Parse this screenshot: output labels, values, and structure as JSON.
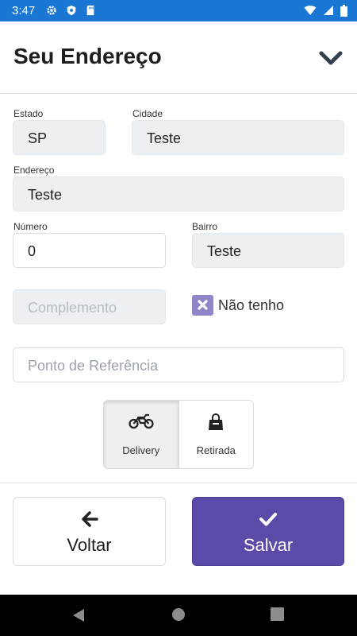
{
  "status_bar": {
    "time": "3:47"
  },
  "header": {
    "title": "Seu Endereço"
  },
  "form": {
    "estado": {
      "label": "Estado",
      "value": "SP"
    },
    "cidade": {
      "label": "Cidade",
      "value": "Teste"
    },
    "endereco": {
      "label": "Endereço",
      "value": "Teste"
    },
    "numero": {
      "label": "Número",
      "value": "0"
    },
    "bairro": {
      "label": "Bairro",
      "value": "Teste"
    },
    "complemento": {
      "placeholder": "Complemento"
    },
    "nao_tenho": {
      "label": "Não tenho",
      "checked": true
    },
    "referencia": {
      "placeholder": "Ponto de Referência"
    }
  },
  "delivery_options": [
    {
      "label": "Delivery",
      "icon": "motorcycle-icon",
      "selected": true
    },
    {
      "label": "Retirada",
      "icon": "shopping-bag-icon",
      "selected": false
    }
  ],
  "buttons": {
    "back": {
      "label": "Voltar",
      "icon": "arrow-left-icon"
    },
    "save": {
      "label": "Salvar",
      "icon": "check-icon"
    }
  },
  "colors": {
    "status_bar": "#1976d2",
    "primary": "#5b4aa8",
    "checkbox": "#8e86c7"
  }
}
